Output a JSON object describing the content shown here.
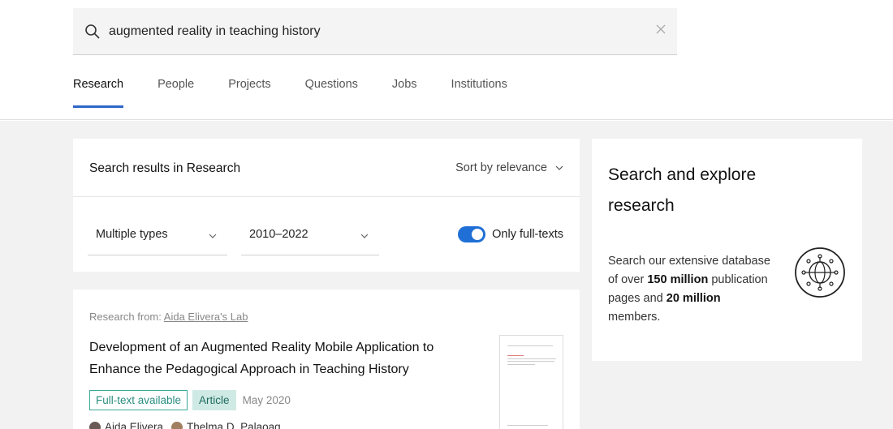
{
  "search": {
    "query": "augmented reality in teaching history"
  },
  "tabs": [
    {
      "label": "Research"
    },
    {
      "label": "People"
    },
    {
      "label": "Projects"
    },
    {
      "label": "Questions"
    },
    {
      "label": "Jobs"
    },
    {
      "label": "Institutions"
    }
  ],
  "results": {
    "title": "Search results in Research",
    "sort_label": "Sort by relevance",
    "filter_types": "Multiple types",
    "filter_years": "2010–2022",
    "toggle_label": "Only full-texts",
    "toggle_on": true
  },
  "sidebar": {
    "title": "Search and explore research",
    "text_1": "Search our extensive database of over",
    "bold_1": "150 million",
    "text_2": "publication pages and",
    "bold_2": "20 million",
    "text_3": "members."
  },
  "result_card": {
    "from_prefix": "Research from:",
    "from_lab": "Aida Elivera's Lab",
    "title": "Development of an Augmented Reality Mobile Application to Enhance the Pedagogical Approach in Teaching History",
    "badge_fulltext": "Full-text available",
    "badge_type": "Article",
    "date": "May 2020",
    "authors": [
      "Aida Elivera",
      "Thelma D. Palaoag"
    ]
  },
  "colors": {
    "accent": "#2f66c8",
    "toggle": "#1f6fd6",
    "teal": "#3aa99a"
  }
}
